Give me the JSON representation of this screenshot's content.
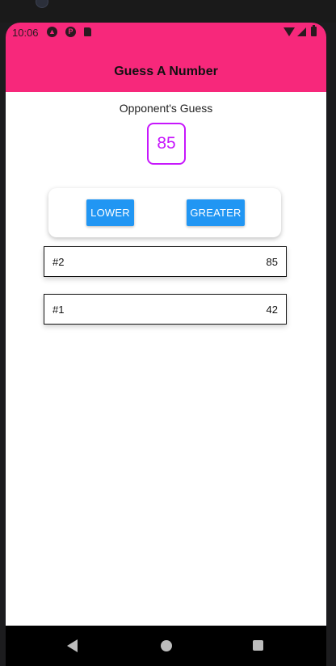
{
  "status_bar": {
    "time": "10:06",
    "icons": [
      "expo-icon",
      "notification-icon",
      "sd-card-icon",
      "wifi-icon",
      "signal-icon",
      "battery-icon"
    ]
  },
  "header": {
    "title": "Guess A Number",
    "background_color": "#f7287b"
  },
  "game": {
    "opponent_label": "Opponent's Guess",
    "current_guess": "85",
    "accent_color": "#c717fc"
  },
  "controls": {
    "lower_label": "LOWER",
    "greater_label": "GREATER",
    "button_color": "#2196f3"
  },
  "guesses": [
    {
      "round": "#2",
      "value": "85"
    },
    {
      "round": "#1",
      "value": "42"
    }
  ],
  "nav": {
    "icons": [
      "back-icon",
      "home-icon",
      "recents-icon"
    ]
  }
}
